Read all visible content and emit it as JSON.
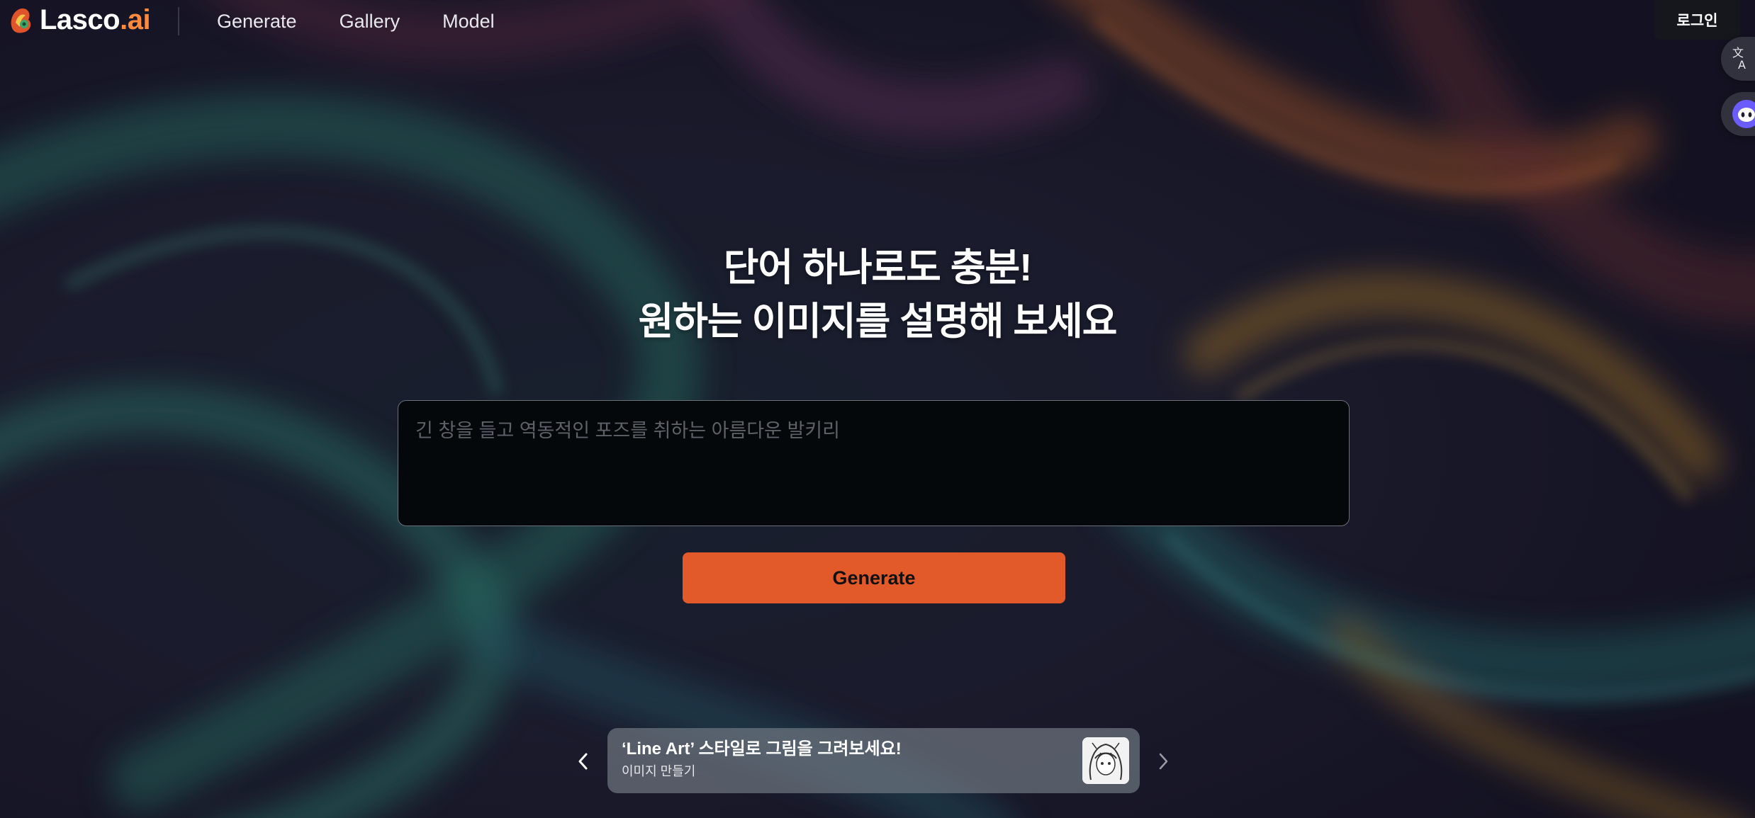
{
  "header": {
    "logo_text": "Lasco",
    "logo_suffix": ".ai",
    "nav": [
      {
        "label": "Generate"
      },
      {
        "label": "Gallery"
      },
      {
        "label": "Model"
      }
    ],
    "login_label": "로그인"
  },
  "side_buttons": {
    "translate_icon": "translate-icon",
    "chat_icon": "chat-bot-icon"
  },
  "hero": {
    "line1": "단어 하나로도 충분!",
    "line2": "원하는 이미지를 설명해 보세요"
  },
  "prompt": {
    "placeholder": "긴 창을 들고 역동적인 포즈를 취하는 아름다운 발키리",
    "value": ""
  },
  "generate_label": "Generate",
  "banner": {
    "title": "‘Line Art’ 스타일로 그림을 그려보세요!",
    "subtitle": "이미지 만들기"
  },
  "colors": {
    "accent": "#e35a2a",
    "prompt_bg": "#05080b",
    "login_bg": "#15171d"
  }
}
